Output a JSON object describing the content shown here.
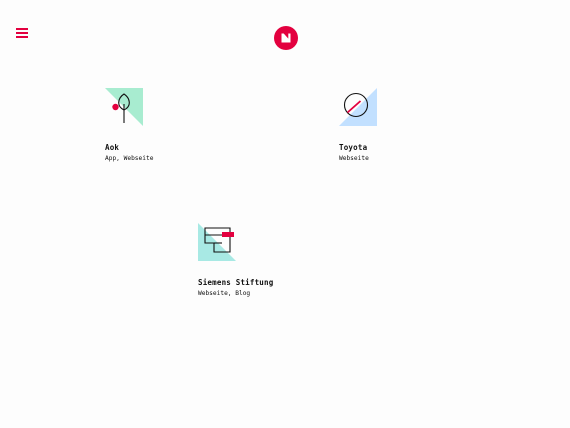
{
  "colors": {
    "accent": "#e3003f",
    "mint": "#a8ecd0",
    "blue": "#c2e0ff",
    "aqua": "#a8e9e4"
  },
  "header": {
    "menu_icon": "hamburger-icon",
    "logo_icon": "brand-logo-icon"
  },
  "projects": [
    {
      "title": "Aok",
      "tags": "App, Webseite",
      "icon": "tree-icon"
    },
    {
      "title": "Toyota",
      "tags": "Webseite",
      "icon": "speedometer-icon"
    },
    {
      "title": "Siemens Stiftung",
      "tags": "Webseite, Blog",
      "icon": "puzzle-blocks-icon"
    }
  ]
}
